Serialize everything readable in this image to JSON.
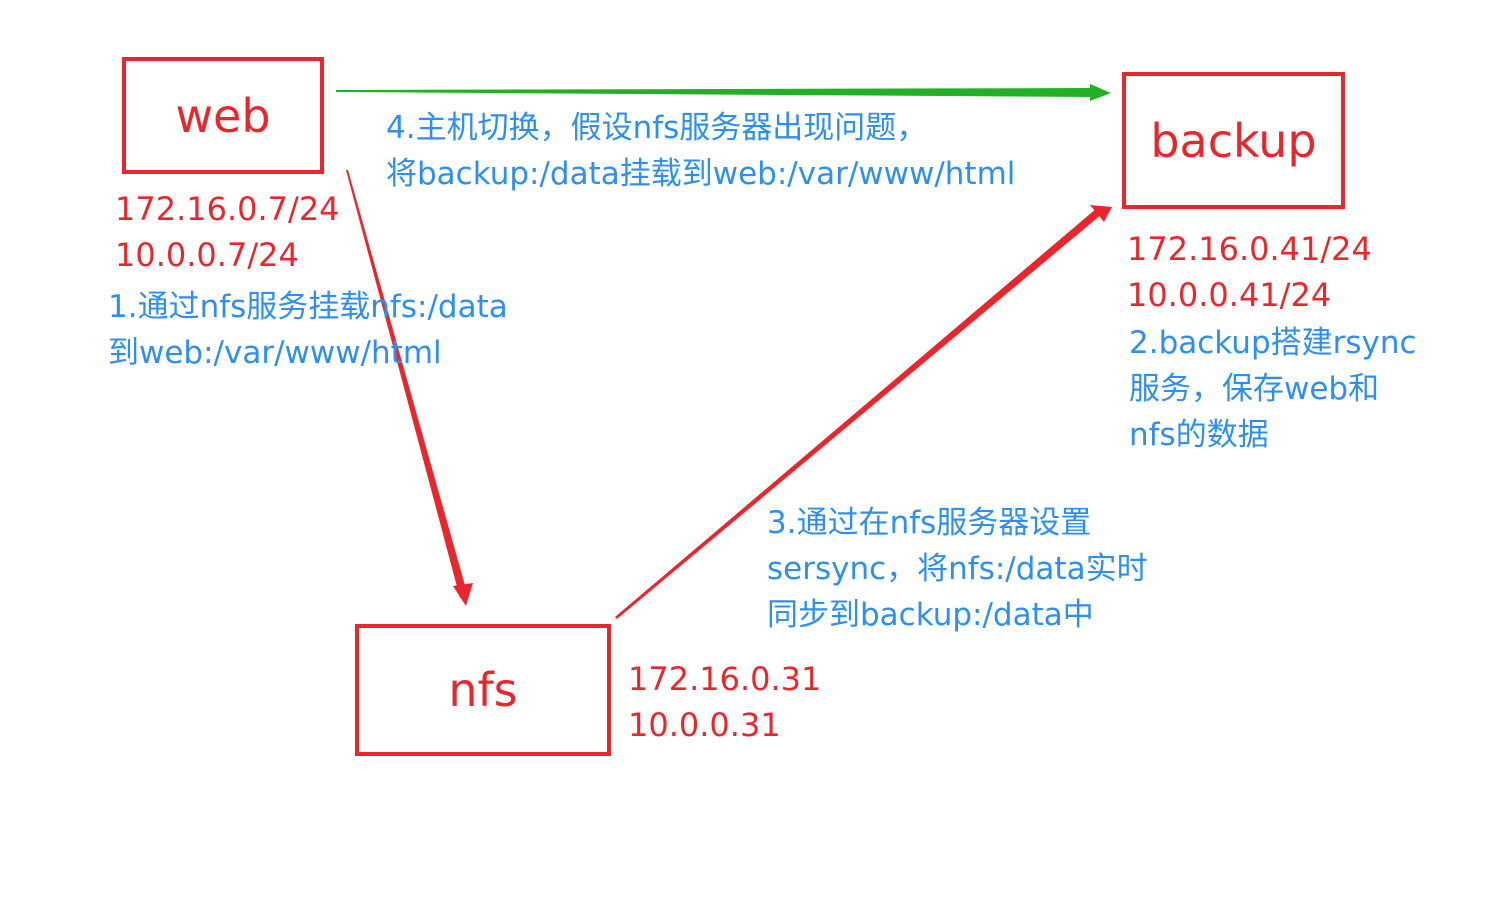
{
  "nodes": {
    "web": "web",
    "backup": "backup",
    "nfs": "nfs"
  },
  "addresses": {
    "web": [
      "172.16.0.7/24",
      "10.0.0.7/24"
    ],
    "backup": [
      "172.16.0.41/24",
      "10.0.0.41/24"
    ],
    "nfs": [
      "172.16.0.31",
      "10.0.0.31"
    ]
  },
  "notes": {
    "step1": [
      "1.通过nfs服务挂载nfs:/data",
      "到web:/var/www/html"
    ],
    "step2": [
      "2.backup搭建rsync",
      "服务，保存web和",
      "nfs的数据"
    ],
    "step3": [
      "3.通过在nfs服务器设置",
      "sersync，将nfs:/data实时",
      "同步到backup:/data中"
    ],
    "step4": [
      "4.主机切换，假设nfs服务器出现问题，",
      "将backup:/data挂载到web:/var/www/html"
    ]
  },
  "colors": {
    "box": "#e8262c",
    "address_text": "#e8262c",
    "note_text": "#2d8ff0",
    "arrow_mount": "#e8262c",
    "arrow_sync": "#e8262c",
    "arrow_failover": "#22b024"
  }
}
